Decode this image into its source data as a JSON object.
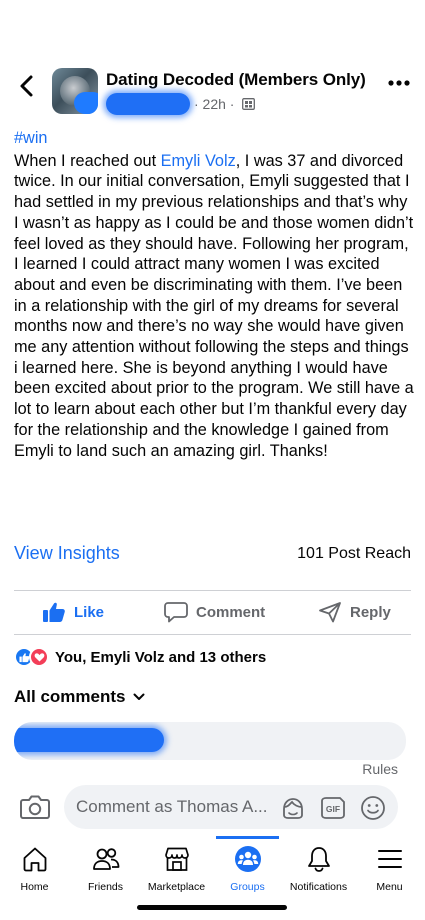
{
  "header": {
    "group_name": "Dating Decoded (Members Only)",
    "timestamp": "· 22h ·"
  },
  "post": {
    "hashtag": "#win",
    "text_before_mention": "When I reached out ",
    "mention": "Emyli Volz",
    "text_after_mention": ", I was 37 and divorced twice.  In our initial conversation, Emyli suggested that I had settled in my previous relationships and that’s why I wasn’t as happy as I could be and those women didn’t feel loved as they should have.  Following her program, I learned I could attract many women I was excited about and even be discriminating with them.  I’ve been in a relationship with the girl of my dreams for several months now and there’s no way she would have given me any attention without following the steps and things i learned here. She is beyond anything I would have been excited about prior to the program.  We still have a lot to learn about each other but I’m thankful every day for the relationship and the knowledge I gained from Emyli to land such an amazing girl. Thanks!"
  },
  "stats": {
    "insights_label": "View Insights",
    "reach_label": "101 Post Reach"
  },
  "actions": {
    "like_label": "Like",
    "comment_label": "Comment",
    "reply_label": "Reply"
  },
  "reactions": {
    "summary": "You, Emyli Volz and 13 others"
  },
  "comments": {
    "header": "All comments",
    "rules_label": "Rules"
  },
  "composer": {
    "placeholder": "Comment as Thomas A..."
  },
  "tabs": [
    {
      "label": "Home",
      "icon": "home-icon"
    },
    {
      "label": "Friends",
      "icon": "friends-icon"
    },
    {
      "label": "Marketplace",
      "icon": "marketplace-icon"
    },
    {
      "label": "Groups",
      "icon": "groups-icon",
      "active": true
    },
    {
      "label": "Notifications",
      "icon": "bell-icon"
    },
    {
      "label": "Menu",
      "icon": "menu-icon"
    }
  ],
  "colors": {
    "accent": "#1b6ff2",
    "muted": "#65676b",
    "love": "#f33e58"
  }
}
